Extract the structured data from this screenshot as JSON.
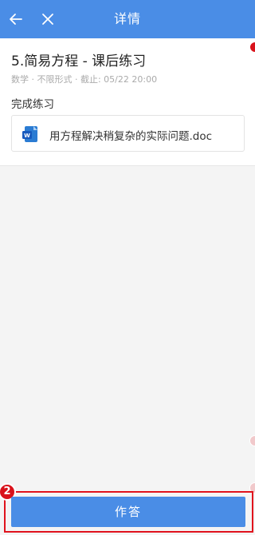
{
  "header": {
    "title": "详情",
    "back_icon": "back-arrow-icon",
    "close_icon": "close-icon",
    "bg_color": "#4a8de6"
  },
  "assignment": {
    "title": "5.简易方程 - 课后练习",
    "meta": "数学 · 不限形式 · 截止: 05/22 20:00",
    "section_label": "完成练习",
    "attachment": {
      "icon": "word-document-icon",
      "name": "用方程解决稍复杂的实际问题.doc"
    }
  },
  "actions": {
    "submit_label": "作答",
    "submit_color": "#4a8de6"
  },
  "annotations": {
    "badge_number": "2",
    "highlight_color": "#e0131d"
  }
}
